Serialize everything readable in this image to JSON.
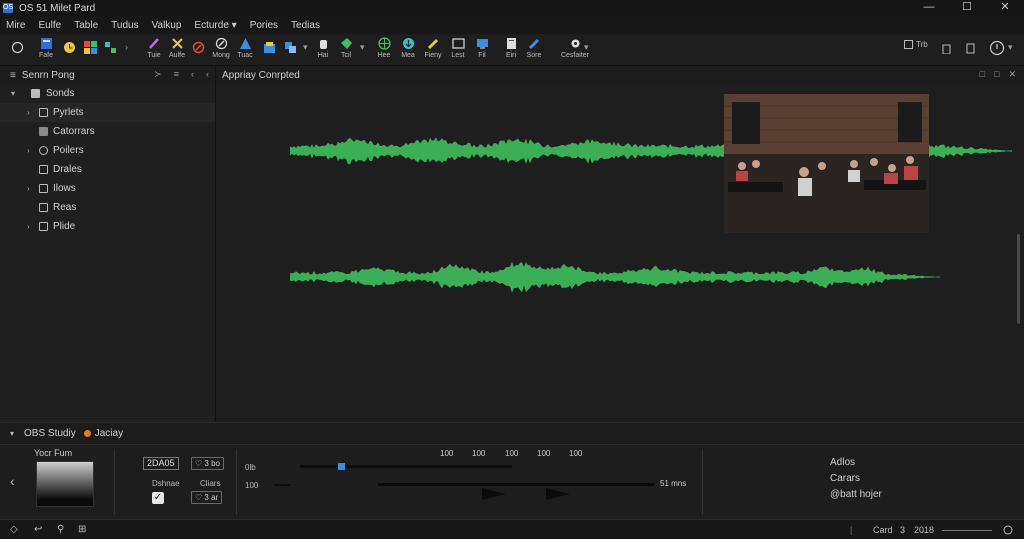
{
  "window": {
    "logo": "OS",
    "title": "OS 51 Milet Pard",
    "controls": [
      "—",
      "☐",
      "✕"
    ]
  },
  "menu": [
    "Mire",
    "Eulfe",
    "Table",
    "Tudus",
    "Valkup",
    "Ecturde ▾",
    "Pories",
    "Tedias"
  ],
  "toolbar": {
    "labels": [
      "Fafe",
      "Tuie",
      "Aulfe",
      "Mong",
      "Tuac",
      "Hai",
      "Tcil",
      "Hee",
      "Mea",
      "Fieny",
      "Lest",
      "Fil",
      "Eiri",
      "Sore",
      "Cesfaiter"
    ],
    "right_label": "Trb",
    "colors": {
      "accent_blue": "#3a8fe0",
      "accent_yellow": "#e8c64a",
      "accent_red": "#e04b3a",
      "accent_green": "#3fbf63",
      "accent_purple": "#c06ae0",
      "accent_cyan": "#36c2c2"
    }
  },
  "left_panel": {
    "title": "Senrn Pong",
    "controls": [
      "≻",
      "≡",
      "‹",
      "‹"
    ],
    "tree": [
      {
        "label": "Sonds",
        "arrow": "▾",
        "icon": "folder-icon"
      },
      {
        "label": "Pyrlets",
        "arrow": "›",
        "icon": "page-icon"
      },
      {
        "label": "Catorrars",
        "arrow": "",
        "icon": "grid-icon"
      },
      {
        "label": "Poilers",
        "arrow": "›",
        "icon": "gear-icon"
      },
      {
        "label": "Drales",
        "arrow": "",
        "icon": "page-icon"
      },
      {
        "label": "Ilows",
        "arrow": "›",
        "icon": "page-icon"
      },
      {
        "label": "Reas",
        "arrow": "",
        "icon": "page-icon"
      },
      {
        "label": "Plide",
        "arrow": "›",
        "icon": "page-icon"
      }
    ]
  },
  "main": {
    "title": "Appriay Conrpted",
    "controls": [
      "□",
      "□",
      "✕"
    ],
    "waveform_color": "#3cae55"
  },
  "dock": {
    "title": "OBS Studiy",
    "status": "Jaciay",
    "color_label": "Yocr Fum",
    "timecode": "2DA05",
    "btn1": "♡ 3 bo",
    "checkbox_label": "Dshnae",
    "clears_label": "Cliars",
    "btn2": "♡ 3 ar",
    "label_db": "0lb",
    "label_100": "100",
    "ruler": [
      "100",
      "100",
      "100",
      "100",
      "100"
    ],
    "time_right": "51 mns",
    "right_items": [
      "Adlos",
      "Carars",
      "@batt hojer"
    ]
  },
  "status_bar": {
    "card": "Card",
    "page": "3",
    "year": "2018",
    "icons": [
      "◇",
      "↩",
      "⚲",
      "⊞"
    ]
  }
}
